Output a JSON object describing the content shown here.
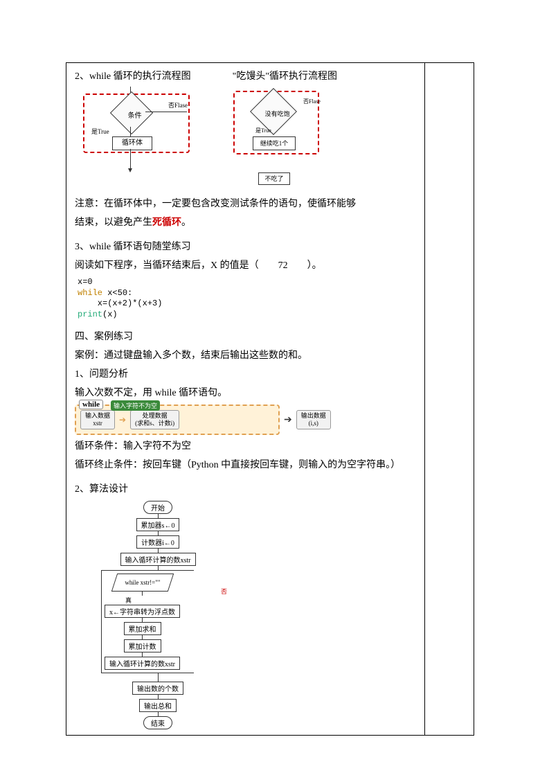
{
  "sec1": {
    "title": "2、while 循环的执行流程图",
    "title2": "\"吃馒头\"循环执行流程图",
    "fc1": {
      "cond": "条件",
      "true": "是True",
      "false": "否Flase",
      "body": "循环体"
    },
    "fc2": {
      "cond": "没有吃饱",
      "true": "是True",
      "false": "否Flase",
      "body": "继续吃1个",
      "end": "不吃了"
    }
  },
  "note": {
    "p1": "注意：在循环体中，一定要包含改变测试条件的语句，使循环能够",
    "p2a": "结束，以避免产生",
    "p2b": "死循环",
    "p2c": "。"
  },
  "sec2": {
    "title": "3、while 循环语句随堂练习",
    "q": "阅读如下程序，当循环结束后，X 的值是（　　72　　）。",
    "code": {
      "l1": "x=0",
      "l2a": "while",
      "l2b": " x<50:",
      "l3": "    x=(x+2)*(x+3)",
      "l4a": "print",
      "l4b": "(x)"
    }
  },
  "sec3": {
    "title": "四、案例练习",
    "desc": "案例：通过键盘输入多个数，结束后输出这些数的和。",
    "a1": "1、问题分析",
    "a2": "输入次数不定，用 while 循环语句。",
    "pipe": {
      "while": "while",
      "bubble": "输入字符不为空",
      "b1a": "输入数据",
      "b1b": "xstr",
      "b2a": "处理数据",
      "b2b": "(求和s、计数i)",
      "outa": "输出数据",
      "outb": "(i,s)"
    },
    "c1": "循环条件：输入字符不为空",
    "c2": "循环终止条件：按回车键（Python 中直接按回车键，则输入的为空字符串。）"
  },
  "sec4": {
    "title": "2、算法设计",
    "flow": {
      "start": "开始",
      "s1": "累加器s←0",
      "s2": "计数器i←0",
      "s3": "输入循环计算的数xstr",
      "cond": "while xstr!=\"\"",
      "yes": "真",
      "no": "否",
      "b1": "x←字符串转为浮点数",
      "b2": "累加求和",
      "b3": "累加计数",
      "b4": "输入循环计算的数xstr",
      "o1": "输出数的个数",
      "o2": "输出总和",
      "end": "结束"
    }
  }
}
